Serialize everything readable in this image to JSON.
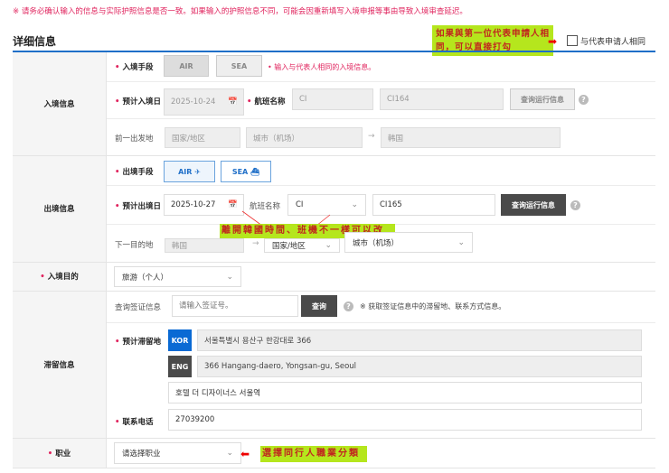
{
  "notice": "※ 请务必确认输入的信息与实际护照信息是否一致。如果输入的护照信息不同，可能会因重新填写入境申报等事由导致入境审查延迟。",
  "section_title": "详细信息",
  "same_as_rep": {
    "label": "与代表申请人相同",
    "checked": false
  },
  "annotations": {
    "top": "如果與第一位代表申請人相同，可以直接打勾",
    "departure": "離開韓國時間、班機不一樣可以改",
    "job": "選擇同行人職業分類"
  },
  "entry": {
    "section": "入境信息",
    "mode_label": "入境手段",
    "air": "AIR",
    "sea": "SEA",
    "mode_note": "输入与代表人相同的入境信息。",
    "date_label": "预计入境日",
    "date": "2025-10-24",
    "flight_label": "航班名称",
    "airline": "CI",
    "flight": "CI164",
    "lookup": "查询运行信息",
    "prev_label": "前一出发地",
    "prev_country": "国家/地区",
    "prev_city": "城市（机场）",
    "dest": "韩国"
  },
  "exit": {
    "section": "出境信息",
    "mode_label": "出境手段",
    "air": "AIR",
    "sea": "SEA",
    "date_label": "预计出境日",
    "date": "2025-10-27",
    "flight_label": "航班名称",
    "airline": "CI",
    "flight": "CI165",
    "lookup": "查询运行信息",
    "next_label": "下一目的地",
    "origin": "韩国",
    "next_country": "国家/地区",
    "next_city": "城市（机场）"
  },
  "purpose": {
    "label": "入境目的",
    "value": "旅游（个人）"
  },
  "stay": {
    "section": "滞留信息",
    "visa_label": "查询签证信息",
    "visa_placeholder": "请输入签证号。",
    "visa_btn": "查询",
    "visa_note": "※ 获取签证信息中的滞留地、联系方式信息。",
    "addr_label": "预计滞留地",
    "kor": "KOR",
    "kor_addr": "서울특별시 용산구 한강대로 366",
    "eng": "ENG",
    "eng_addr": "366 Hangang-daero, Yongsan-gu, Seoul",
    "hotel": "호텔 더 디자이너스 서울역",
    "phone_label": "联系电话",
    "phone": "27039200"
  },
  "job": {
    "label": "职业",
    "value": "请选择职业"
  },
  "colors": {
    "accent": "#1f6fc8",
    "required": "#e0245e",
    "highlight": "#b5e61d"
  }
}
